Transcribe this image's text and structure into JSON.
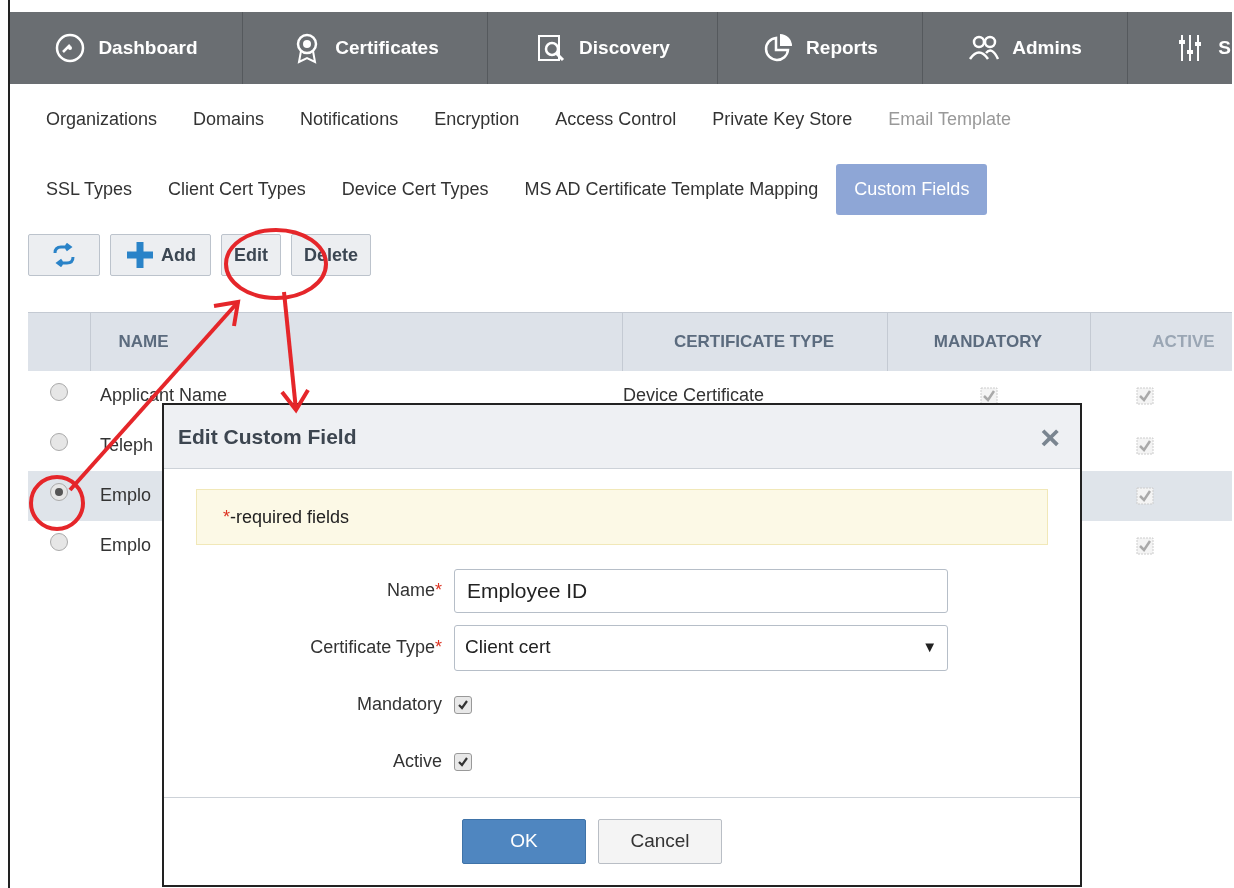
{
  "nav": [
    {
      "kind": "gauge",
      "label": "Dashboard"
    },
    {
      "kind": "rosette",
      "label": "Certificates"
    },
    {
      "kind": "scan",
      "label": "Discovery"
    },
    {
      "kind": "pie",
      "label": "Reports"
    },
    {
      "kind": "people",
      "label": "Admins"
    },
    {
      "kind": "sliders",
      "label": "S"
    }
  ],
  "subtabs": [
    [
      {
        "label": "Organizations",
        "selected": false,
        "faded": false
      },
      {
        "label": "Domains",
        "selected": false,
        "faded": false
      },
      {
        "label": "Notifications",
        "selected": false,
        "faded": false
      },
      {
        "label": "Encryption",
        "selected": false,
        "faded": false
      },
      {
        "label": "Access Control",
        "selected": false,
        "faded": false
      },
      {
        "label": "Private Key Store",
        "selected": false,
        "faded": false
      },
      {
        "label": "Email Template",
        "selected": false,
        "faded": true
      }
    ],
    [
      {
        "label": "SSL Types",
        "selected": false,
        "faded": false
      },
      {
        "label": "Client Cert Types",
        "selected": false,
        "faded": false
      },
      {
        "label": "Device Cert Types",
        "selected": false,
        "faded": false
      },
      {
        "label": "MS AD Certificate Template Mapping",
        "selected": false,
        "faded": false
      },
      {
        "label": "Custom Fields",
        "selected": true,
        "faded": false
      }
    ]
  ],
  "toolbar": [
    {
      "kind": "refresh"
    },
    {
      "kind": "add",
      "label": "Add"
    },
    {
      "kind": "text",
      "label": "Edit"
    },
    {
      "kind": "text",
      "label": "Delete"
    }
  ],
  "table": {
    "columns": [
      "NAME",
      "CERTIFICATE TYPE",
      "MANDATORY",
      "ACTIVE"
    ],
    "rows": [
      {
        "selected": false,
        "name": "Applicant Name",
        "certificate_type": "Device Certificate",
        "mandatory": true,
        "active": true
      },
      {
        "selected": false,
        "name": "Teleph",
        "active": true
      },
      {
        "selected": true,
        "name": "Emplo",
        "active": true
      },
      {
        "selected": false,
        "name": "Emplo",
        "active": true
      }
    ]
  },
  "dialog": {
    "title": "Edit Custom Field",
    "close": "×",
    "notice": {
      "mark": "*",
      "text": "-required fields"
    },
    "fields": [
      {
        "kind": "text",
        "label": "Name",
        "mark": "*",
        "value": "Employee ID"
      },
      {
        "kind": "select",
        "label": "Certificate Type",
        "mark": "*",
        "value": "Client cert",
        "caret": "▼"
      },
      {
        "kind": "checkbox",
        "label": "Mandatory",
        "checked": true
      },
      {
        "kind": "checkbox",
        "label": "Active",
        "checked": true
      }
    ],
    "buttons": [
      {
        "label": "OK",
        "primary": true
      },
      {
        "label": "Cancel",
        "primary": false
      }
    ]
  }
}
